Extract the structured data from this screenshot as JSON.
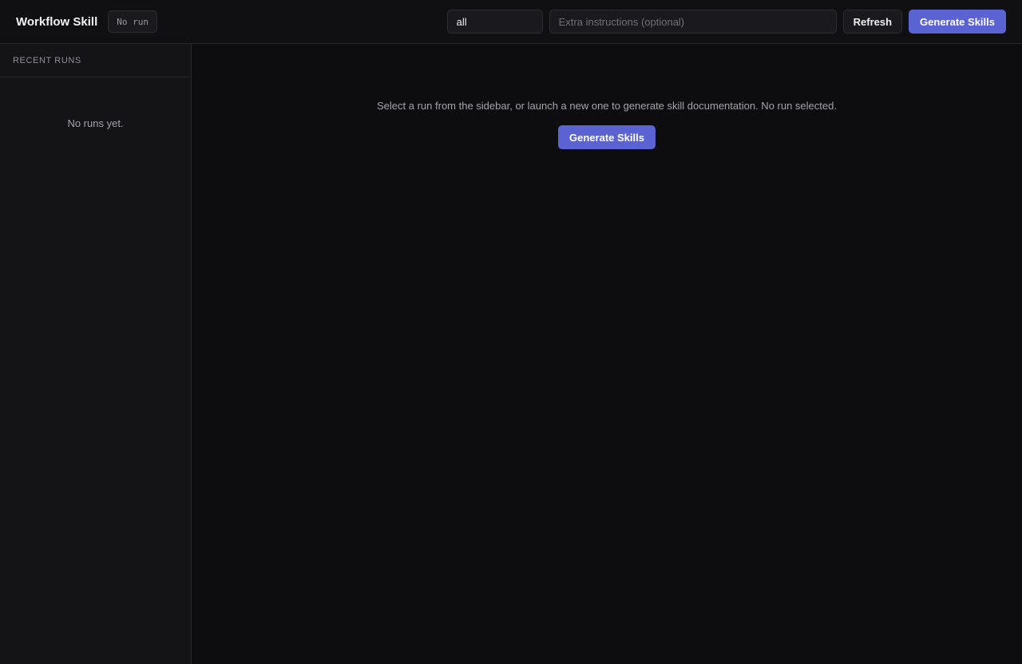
{
  "header": {
    "title": "Workflow Skill",
    "run_badge": "No run",
    "scope_value": "all",
    "instructions_placeholder": "Extra instructions (optional)",
    "instructions_value": "",
    "refresh_label": "Refresh",
    "generate_label": "Generate Skills"
  },
  "sidebar": {
    "heading": "RECENT RUNS",
    "empty_text": "No runs yet."
  },
  "main": {
    "empty_message": "Select a run from the sidebar, or launch a new one to generate skill documentation. No run selected.",
    "generate_label": "Generate Skills"
  },
  "colors": {
    "accent": "#5b63d3",
    "background": "#0d0d10",
    "sidebar_background": "#141417",
    "border": "#26262b"
  }
}
